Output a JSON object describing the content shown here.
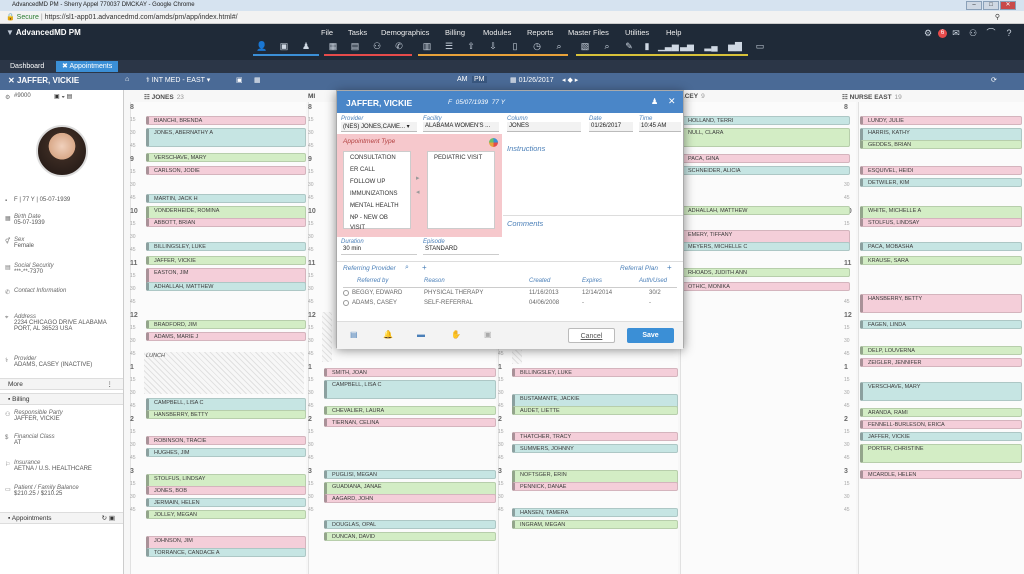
{
  "window": {
    "title": "AdvancedMD PM - Sherry Appel 770037 DMCKAY - Google Chrome"
  },
  "browser": {
    "secure_label": "Secure",
    "url": "https://sl1-app01.advancedmd.com/amds/pm/app/index.html#/"
  },
  "app": {
    "logo": "AdvancedMD PM",
    "menu": [
      "File",
      "Tasks",
      "Demographics",
      "Billing",
      "Modules",
      "Reports",
      "Master Files",
      "Utilities",
      "Help"
    ],
    "badge_count": "6"
  },
  "tabs": [
    {
      "label": "Dashboard"
    },
    {
      "label": "Appointments"
    }
  ],
  "banner": {
    "patient_name": "JAFFER, VICKIE",
    "facility": "INT MED - EAST",
    "am": "AM",
    "pm": "PM",
    "date": "01/26/2017"
  },
  "patient": {
    "id": "#9000",
    "summary": "F | 77 Y | 05-07-1939",
    "birth_label": "Birth Date",
    "birth": "05-07-1939",
    "sex_label": "Sex",
    "sex": "Female",
    "ssn_label": "Social Security",
    "ssn": "***-**-7370",
    "contact_label": "Contact Information",
    "address_label": "Address",
    "address": "2234 CHICAGO DRIVE ALABAMA PORT, AL 36523 USA",
    "provider_label": "Provider",
    "provider": "ADAMS, CASEY (INACTIVE)",
    "more": "More",
    "billing": "Billing",
    "resp_label": "Responsible Party",
    "resp": "JAFFER, VICKIE",
    "fin_label": "Financial Class",
    "fin": "AT",
    "ins_label": "Insurance",
    "ins": "AETNA / U.S. HEALTHCARE",
    "bal_label": "Patient / Family Balance",
    "bal": "$210.25 / $210.25",
    "appointments": "Appointments"
  },
  "schedule": {
    "columns": [
      {
        "name": "JONES",
        "count": "23"
      },
      {
        "name": "MI",
        "count": ""
      },
      {
        "name": "ACEY",
        "count": "9"
      },
      {
        "name": "NURSE EAST",
        "count": "19"
      }
    ],
    "col1": [
      "BIANCHI, BRENDA",
      "JONES, ABERNATHY A",
      "VERSCHAVE, MARY",
      "CARLSON, JODIE",
      "MARTIN, JACK H",
      "VONDERHEIDE, ROMINA",
      "ABBOTT, BRIAN",
      "BILLINGSLEY, LUKE",
      "JAFFER, VICKIE",
      "EASTON, JIM",
      "ADHALLAH, MATTHEW",
      "BRADFORD, JIM",
      "ADAMS, MARIE J",
      "CAMPBELL, LISA C",
      "HANSBERRY, BETTY",
      "ROBINSON, TRACIE",
      "HUGHES, JIM",
      "STOLFUS, LINDSAY",
      "JONES, BOB",
      "JERMAIN, HELEN",
      "JOLLEY, MEGAN",
      "JOHNSON, JIM",
      "TORRANCE, CANDACE A"
    ],
    "lunch": "LUNCH",
    "col2": [
      "SMITH, JOAN",
      "CAMPBELL, LISA C",
      "CHEVALIER, LAURA",
      "TIERNAN, CELINA",
      "PUGLISI, MEGAN",
      "GUADIANA, JANAE",
      "AAGARD, JOHN",
      "DOUGLAS, OPAL",
      "DUNCAN, DAVID"
    ],
    "col3": [
      "BILLINGSLEY, LUKE",
      "BUSTAMANTE, JACKIE",
      "AUDET, LIETTE",
      "THATCHER, TRACY",
      "SUMMERS, JOHNNY",
      "NOFTSGER, ERIN",
      "PENNICK, DANAE",
      "HANSEN, TAMERA",
      "INGRAM, MEGAN"
    ],
    "col3top": [
      "HOLLAND, TERRI",
      "NULL, CLARA",
      "PACA, GINA",
      "SCHNEIDER, ALICIA",
      "ADHALLAH, MATTHEW",
      "EMERY, TIFFANY",
      "MEYERS, MICHELLE C",
      "RHOADS, JUDITH ANN",
      "OTHIC, MONIKA"
    ],
    "col4": [
      "LUNDY, JULIE",
      "HARRIS, KATHY",
      "GEDDES, BRIAN",
      "ESQUIVEL, HEIDI",
      "DETWILER, KIM",
      "WHITE, MICHELLE A",
      "STOLFUS, LINDSAY",
      "PACA, MOBASHA",
      "KRAUSE, SARA",
      "HANSBERRY, BETTY",
      "FAGEN, LINDA",
      "DELP, LOUVERNA",
      "ZEIGLER, JENNIFER",
      "VERSCHAVE, MARY",
      "ARANDA, RAMI",
      "FENNELL-BURLESON, ERICA",
      "JAFFER, VICKIE",
      "PORTER, CHRISTINE",
      "MCARDLE, HELEN"
    ],
    "hours": [
      "8",
      "9",
      "10",
      "11",
      "12",
      "1",
      "2",
      "3"
    ],
    "quarters": [
      "15",
      "30",
      "45"
    ]
  },
  "dialog": {
    "patient": "JAFFER, VICKIE",
    "sex": "F",
    "dob": "05/07/1939",
    "age": "77 Y",
    "provider_label": "Provider",
    "provider": "(NES) JONES,CAME...",
    "facility_label": "Facility",
    "facility": "ALABAMA WOMEN'S ...",
    "column_label": "Column",
    "column": "JONES",
    "date_label": "Date",
    "date": "01/26/2017",
    "time_label": "Time",
    "time": "10:45 AM",
    "appt_type_label": "Appointment Type",
    "appt_types": [
      "CONSULTATION",
      "ER CALL",
      "FOLLOW UP",
      "IMMUNIZATIONS ...",
      "MENTAL HEALTH ...",
      "NP - NEW OB VISIT"
    ],
    "selected_types": [
      "PEDIATRIC VISIT"
    ],
    "instructions_label": "Instructions",
    "comments_label": "Comments",
    "duration_label": "Duration",
    "duration": "30 min",
    "episode_label": "Episode",
    "episode": "STANDARD",
    "referring_label": "Referring Provider",
    "referral_plan_label": "Referral Plan",
    "ref_headers": [
      "Referred by",
      "Reason",
      "Created",
      "Expires",
      "Auth/Used"
    ],
    "ref_rows": [
      {
        "by": "BEGGY, EDWARD",
        "reason": "PHYSICAL THERAPY",
        "created": "11/16/2013",
        "expires": "12/14/2014",
        "auth": "30/2"
      },
      {
        "by": "ADAMS, CASEY",
        "reason": "SELF-REFERRAL",
        "created": "04/06/2008",
        "expires": "-",
        "auth": "-"
      }
    ],
    "cancel": "Cancel",
    "save": "Save"
  }
}
